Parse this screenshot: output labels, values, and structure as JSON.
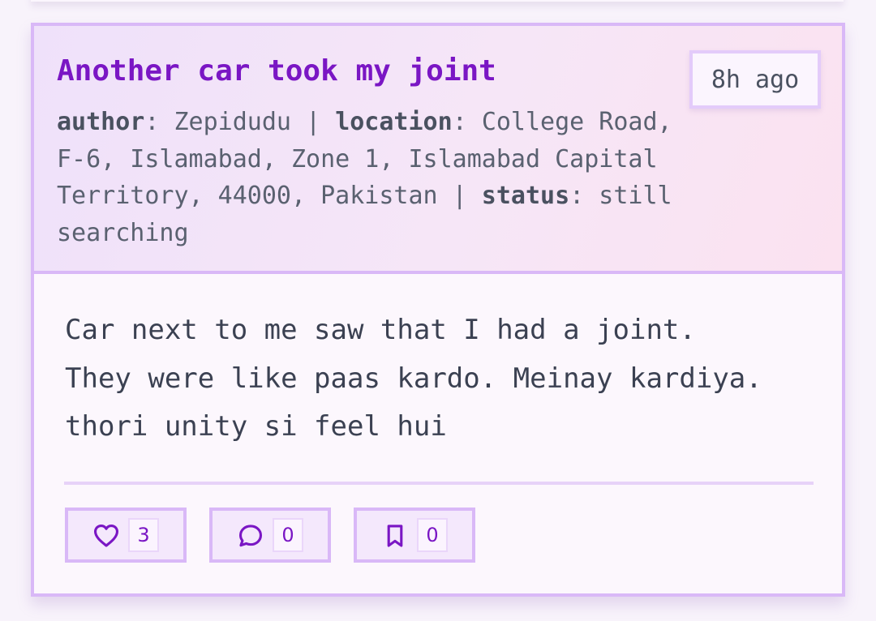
{
  "post": {
    "title": "Another car took my joint",
    "time_ago": "8h ago",
    "meta": {
      "author_key": "author",
      "author": "Zepidudu",
      "location_key": "location",
      "location": "College Road, F-6, Islamabad, Zone 1, Islamabad Capital Territory, 44000, Pakistan",
      "status_key": "status",
      "status": "still searching",
      "separator": "|"
    },
    "body": "Car next to me saw that I had a joint. They were like paas kardo. Meinay kardiya. thori unity si feel hui",
    "actions": [
      {
        "icon": "heart-icon",
        "count": "3"
      },
      {
        "icon": "comment-icon",
        "count": "0"
      },
      {
        "icon": "bookmark-icon",
        "count": "0"
      }
    ]
  },
  "colors": {
    "accent": "#7a16c4",
    "border": "#d9b8f7",
    "text": "#3b4152"
  }
}
